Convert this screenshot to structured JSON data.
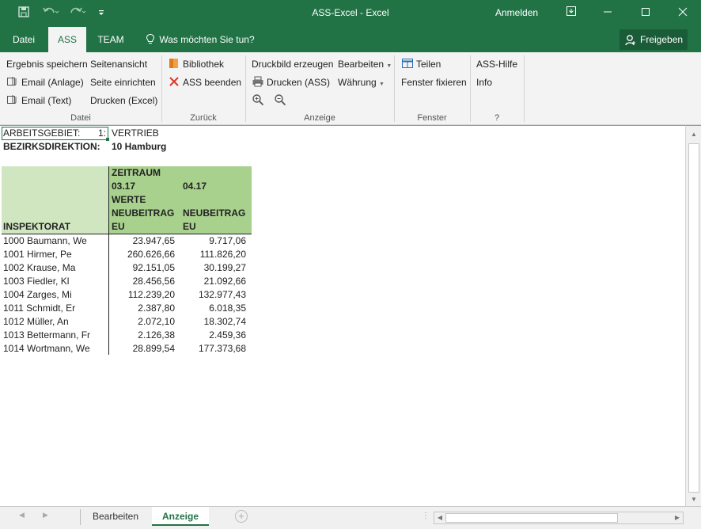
{
  "titlebar": {
    "title": "ASS-Excel  -  Excel",
    "signin": "Anmelden",
    "save_icon": "save-icon",
    "undo_icon": "undo-icon",
    "redo_icon": "redo-icon",
    "customize_icon": "customize-qat-icon",
    "restore_icon": "ribbon-display-icon",
    "minimize_icon": "minimize-icon",
    "maximize_icon": "maximize-icon",
    "close_icon": "close-icon"
  },
  "tabs": {
    "datei": "Datei",
    "ass": "ASS",
    "team": "TEAM",
    "tellme": "Was möchten Sie tun?",
    "share": "Freigeben"
  },
  "ribbon": {
    "datei": {
      "ergebnis_speichern": "Ergebnis speichern",
      "email_anlage": "Email (Anlage)",
      "email_text": "Email (Text)",
      "seitenansicht": "Seitenansicht",
      "seite_einrichten": "Seite einrichten",
      "drucken_excel": "Drucken (Excel)",
      "label": "Datei"
    },
    "zurueck": {
      "bibliothek": "Bibliothek",
      "ass_beenden": "ASS beenden",
      "label": "Zurück"
    },
    "anzeige": {
      "druckbild": "Druckbild erzeugen",
      "drucken_ass": "Drucken (ASS)",
      "bearbeiten": "Bearbeiten",
      "waehrung": "Währung",
      "label": "Anzeige"
    },
    "fenster": {
      "teilen": "Teilen",
      "fenster_fixieren": "Fenster fixieren",
      "label": "Fenster"
    },
    "help": {
      "ass_hilfe": "ASS-Hilfe",
      "info": "Info",
      "label": "?"
    }
  },
  "sheet": {
    "arbeitsgebiet_label": "ARBEITSGEBIET:",
    "arbeitsgebiet_num": "1:",
    "arbeitsgebiet_value": "VERTRIEB",
    "bezirk_label": "BEZIRKSDIREKTION:",
    "bezirk_value": "10 Hamburg",
    "header": {
      "zeitraum": "ZEITRAUM",
      "period1": "03.17",
      "period2": "04.17",
      "werte": "WERTE",
      "col1_line1": "NEUBEITRAG",
      "col1_line2": "EU",
      "col2_line1": "NEUBEITRAG",
      "col2_line2": "EU",
      "inspektorat": "INSPEKTORAT"
    },
    "rows": [
      {
        "name": "1000 Baumann, We",
        "v1": "23.947,65",
        "v2": "9.717,06"
      },
      {
        "name": "1001 Hirmer, Pe",
        "v1": "260.626,66",
        "v2": "111.826,20"
      },
      {
        "name": "1002 Krause, Ma",
        "v1": "92.151,05",
        "v2": "30.199,27"
      },
      {
        "name": "1003 Fiedler, Kl",
        "v1": "28.456,56",
        "v2": "21.092,66"
      },
      {
        "name": "1004 Zarges, Mi",
        "v1": "112.239,20",
        "v2": "132.977,43"
      },
      {
        "name": "1011 Schmidt, Er",
        "v1": "2.387,80",
        "v2": "6.018,35"
      },
      {
        "name": "1012 Müller, An",
        "v1": "2.072,10",
        "v2": "18.302,74"
      },
      {
        "name": "1013 Bettermann, Fr",
        "v1": "2.126,38",
        "v2": "2.459,36"
      },
      {
        "name": "1014 Wortmann, We",
        "v1": "28.899,54",
        "v2": "177.373,68"
      }
    ]
  },
  "sheettabs": {
    "bearbeiten": "Bearbeiten",
    "anzeige": "Anzeige"
  },
  "colors": {
    "accent": "#217346",
    "header_light": "#cfe6c0",
    "header_dark": "#a9d18e"
  }
}
